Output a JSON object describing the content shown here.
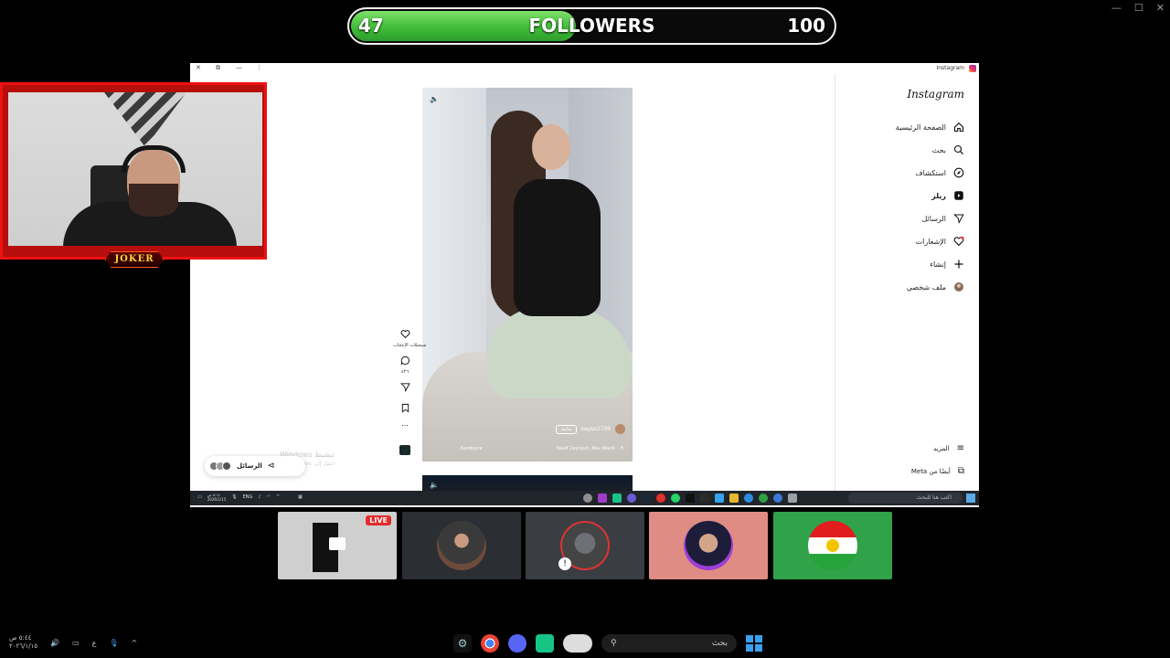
{
  "window_controls": [
    "—",
    "☐",
    "✕"
  ],
  "followers": {
    "current": "47",
    "label": "FOLLOWERS",
    "goal": "100",
    "progress_fraction": 0.47
  },
  "browser": {
    "tab_title": "Instagram",
    "top_controls": [
      "✕",
      "⧉",
      "—",
      "⋮"
    ]
  },
  "instagram": {
    "logo": "Instagram",
    "nav": [
      {
        "label": "الصفحة الرئيسية",
        "icon": "home-icon"
      },
      {
        "label": "بحث",
        "icon": "search-icon"
      },
      {
        "label": "استكشاف",
        "icon": "explore-icon"
      },
      {
        "label": "ريلز",
        "icon": "reels-icon"
      },
      {
        "label": "الرسائل",
        "icon": "send-icon"
      },
      {
        "label": "الإشعارات",
        "icon": "heart-icon"
      },
      {
        "label": "إنشاء",
        "icon": "plus-icon"
      },
      {
        "label": "ملف شخصي",
        "icon": "avatar-icon"
      }
    ],
    "more": "المزيد",
    "meta": "أيضًا من Meta",
    "reel": {
      "username": "sayso2709",
      "follow": "متابعة",
      "music": "Nasif Zeytoun, Abu Wardi · ♬",
      "audio_source": "Kazdoura"
    },
    "actions": {
      "likes_caption": "تسجيلات الإعجاب",
      "comments_count": "٤٢٦",
      "more": "..."
    },
    "messages_label": "الرسائل"
  },
  "watermark": {
    "line1": "تنشيط Windows",
    "line2": "انتقل إلى Windows لتنشيط"
  },
  "inner_taskbar": {
    "time": "٥:١٤ ص",
    "date": "2026/1/15",
    "lang": "ENG",
    "search_placeholder": "اكتب هنا للبحث"
  },
  "webcam": {
    "badge": "JOKER"
  },
  "tiles": {
    "live_badge": "LIVE"
  },
  "sys_taskbar": {
    "time": "٥:٤٤ ص",
    "date": "٢٠٢٦/١/١٥",
    "lang": "ع",
    "search_label": "بحث"
  },
  "colors": {
    "accent_green": "#3fbd39",
    "live_red": "#e52b2b",
    "cam_red": "#e11111"
  }
}
